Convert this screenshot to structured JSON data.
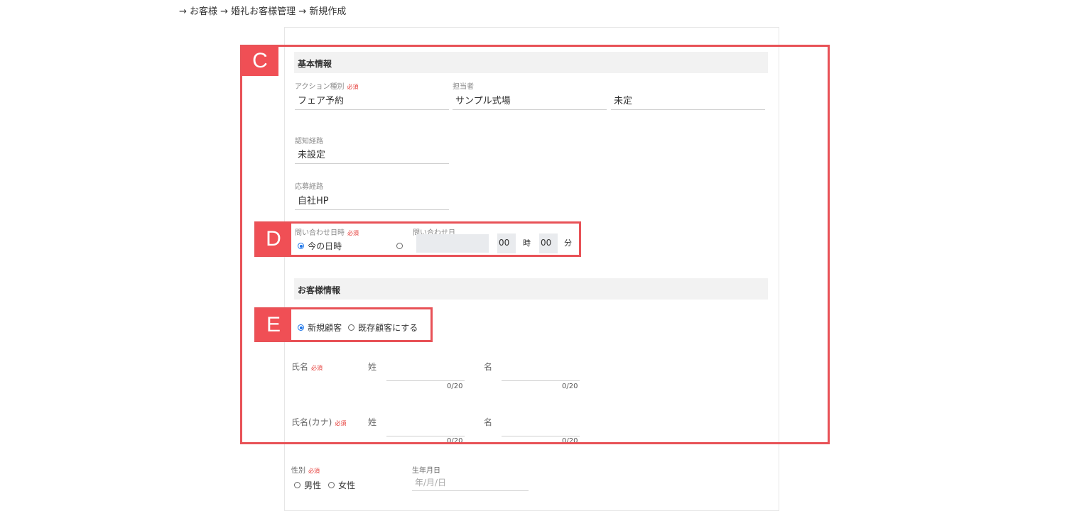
{
  "breadcrumb": "→ お客様 → 婚礼お客様管理 → 新規作成",
  "basic": {
    "title": "基本情報",
    "action_type": {
      "label": "アクション種別",
      "required": "必須",
      "value": "フェア予約"
    },
    "staff": {
      "label": "担当者",
      "value1": "サンプル式場",
      "value2": "未定"
    },
    "awareness": {
      "label": "認知経路",
      "value": "未設定"
    },
    "application": {
      "label": "応募経路",
      "value": "自社HP"
    },
    "inquiry": {
      "label": "問い合わせ日時",
      "required": "必須",
      "now_label": "今の日時",
      "date_label": "問い合わせ日",
      "hour": "00",
      "hour_unit": "時",
      "minute": "00",
      "minute_unit": "分",
      "selected": "now"
    }
  },
  "customer": {
    "title": "お客様情報",
    "type_new": "新規顧客",
    "type_existing": "既存顧客にする",
    "selected": "new",
    "name": {
      "label": "氏名",
      "required": "必須",
      "last": "姓",
      "first": "名",
      "last_count": "0/20",
      "first_count": "0/20"
    },
    "kana": {
      "label": "氏名(カナ)",
      "required": "必須",
      "last": "姓",
      "first": "名",
      "last_count": "0/20",
      "first_count": "0/20"
    },
    "gender": {
      "label": "性別",
      "required": "必須",
      "male": "男性",
      "female": "女性"
    },
    "birth": {
      "label": "生年月日",
      "placeholder": "年/月/日"
    }
  },
  "annotations": {
    "c": "C",
    "d": "D",
    "e": "E",
    "color": "#e85257"
  }
}
